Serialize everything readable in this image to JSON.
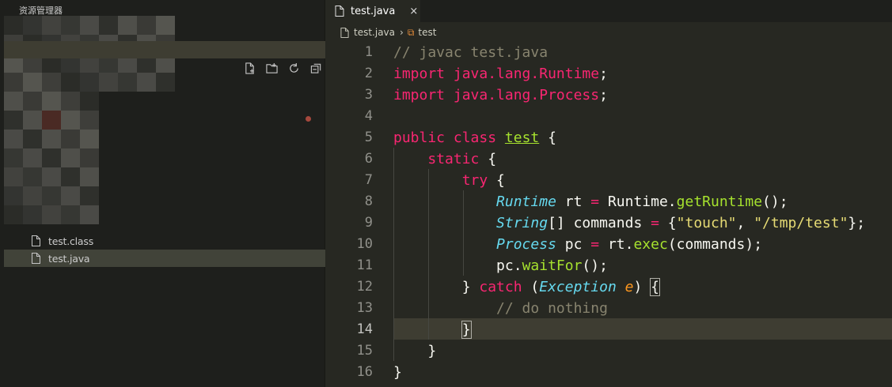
{
  "sidebar": {
    "title": "资源管理器",
    "toolbar": [
      "new-file-icon",
      "new-folder-icon",
      "refresh-icon",
      "collapse-all-icon"
    ],
    "files": [
      {
        "name": "test.class"
      },
      {
        "name": "test.java"
      }
    ]
  },
  "tabs": [
    {
      "label": "test.java",
      "close": "×"
    }
  ],
  "breadcrumb": {
    "file": "test.java",
    "symbol": "test"
  },
  "editor": {
    "lines": [
      {
        "n": "1",
        "tokens": [
          [
            "c-comment",
            "// javac test.java"
          ]
        ]
      },
      {
        "n": "2",
        "tokens": [
          [
            "c-import",
            "import java.lang.Runtime"
          ],
          [
            "",
            ";"
          ]
        ]
      },
      {
        "n": "3",
        "tokens": [
          [
            "c-import",
            "import java.lang.Process"
          ],
          [
            "",
            ";"
          ]
        ]
      },
      {
        "n": "4",
        "tokens": []
      },
      {
        "n": "5",
        "tokens": [
          [
            "c-kw",
            "public class "
          ],
          [
            "c-cls",
            "test"
          ],
          [
            "",
            " {"
          ]
        ]
      },
      {
        "n": "6",
        "tokens": [
          [
            "",
            "    "
          ],
          [
            "c-kw",
            "static"
          ],
          [
            "",
            " {"
          ]
        ]
      },
      {
        "n": "7",
        "tokens": [
          [
            "",
            "        "
          ],
          [
            "c-kw",
            "try"
          ],
          [
            "",
            " {"
          ]
        ]
      },
      {
        "n": "8",
        "tokens": [
          [
            "",
            "            "
          ],
          [
            "c-type",
            "Runtime"
          ],
          [
            "",
            " rt "
          ],
          [
            "c-kw",
            "="
          ],
          [
            "",
            " Runtime."
          ],
          [
            "c-fn",
            "getRuntime"
          ],
          [
            "",
            "();"
          ]
        ]
      },
      {
        "n": "9",
        "tokens": [
          [
            "",
            "            "
          ],
          [
            "c-type",
            "String"
          ],
          [
            "",
            "[] commands "
          ],
          [
            "c-kw",
            "="
          ],
          [
            "",
            " {"
          ],
          [
            "c-str",
            "\"touch\""
          ],
          [
            "",
            ", "
          ],
          [
            "c-str",
            "\"/tmp/test\""
          ],
          [
            "",
            "};"
          ]
        ]
      },
      {
        "n": "10",
        "tokens": [
          [
            "",
            "            "
          ],
          [
            "c-type",
            "Process"
          ],
          [
            "",
            " pc "
          ],
          [
            "c-kw",
            "="
          ],
          [
            "",
            " rt."
          ],
          [
            "c-fn",
            "exec"
          ],
          [
            "",
            "(commands);"
          ]
        ]
      },
      {
        "n": "11",
        "tokens": [
          [
            "",
            "            pc."
          ],
          [
            "c-fn",
            "waitFor"
          ],
          [
            "",
            "();"
          ]
        ]
      },
      {
        "n": "12",
        "tokens": [
          [
            "",
            "        } "
          ],
          [
            "c-kw",
            "catch"
          ],
          [
            "",
            " ("
          ],
          [
            "c-type",
            "Exception"
          ],
          [
            "",
            " "
          ],
          [
            "c-param",
            "e"
          ],
          [
            "",
            ") "
          ],
          [
            "bracket-match",
            "{"
          ]
        ]
      },
      {
        "n": "13",
        "tokens": [
          [
            "",
            "            "
          ],
          [
            "c-comment",
            "// do nothing"
          ]
        ]
      },
      {
        "n": "14",
        "tokens": [
          [
            "",
            "        "
          ],
          [
            "bracket-match",
            "}"
          ]
        ]
      },
      {
        "n": "15",
        "tokens": [
          [
            "",
            "    }"
          ]
        ]
      },
      {
        "n": "16",
        "tokens": [
          [
            "",
            "}"
          ]
        ]
      }
    ],
    "current_line": "14"
  }
}
